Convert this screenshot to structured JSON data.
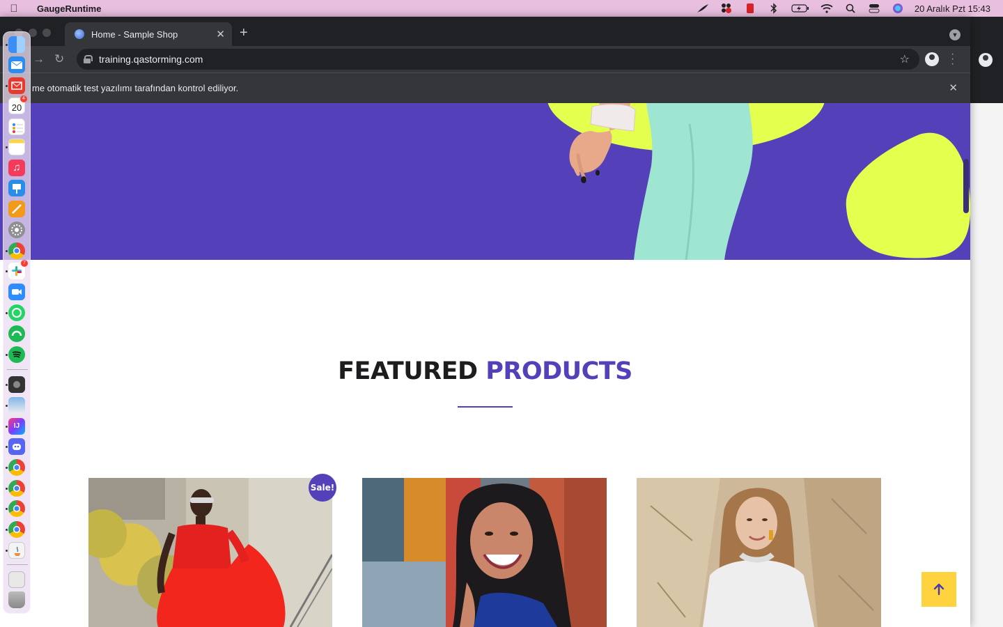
{
  "menubar": {
    "app_name": "GaugeRuntime",
    "datetime": "20 Aralık Pzt  15:43"
  },
  "browser": {
    "tab_title": "Home - Sample Shop",
    "url": "training.qastorming.com",
    "infobar_text": "me otomatik test yazılımı tarafından kontrol ediliyor."
  },
  "page": {
    "featured_word1": "FEATURED",
    "featured_word2": "PRODUCTS",
    "sale_badge": "Sale!",
    "accent_color": "#5440b8",
    "highlight_color": "#e4ff4d"
  },
  "dock": {
    "calendar_day": "20",
    "calendar_badge": "4",
    "slack_badge": "7"
  }
}
